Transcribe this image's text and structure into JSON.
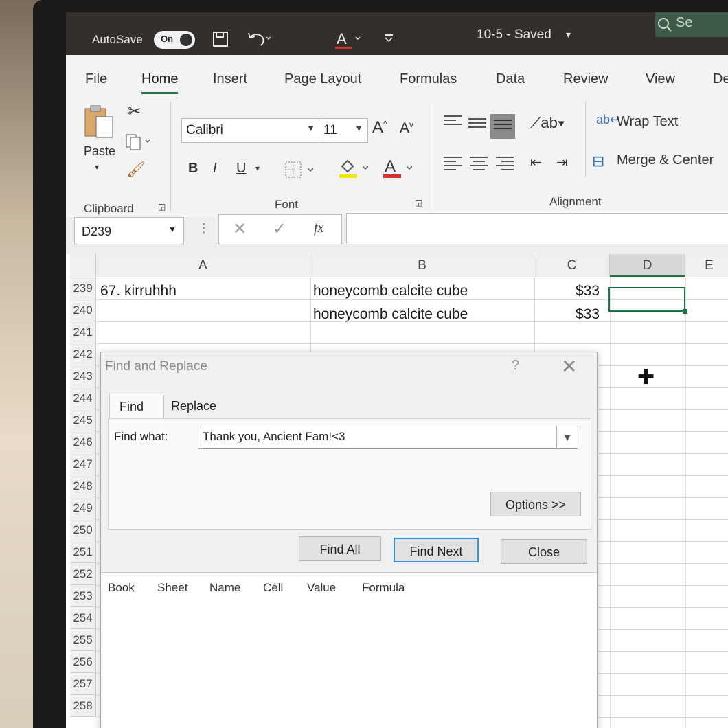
{
  "titlebar": {
    "autosave_label": "AutoSave",
    "autosave_state": "On",
    "document_title": "10-5 - Saved",
    "title_dropdown_icon": "chevron-down-icon",
    "search_partial": "Se"
  },
  "ribbon_tabs": [
    "File",
    "Home",
    "Insert",
    "Page Layout",
    "Formulas",
    "Data",
    "Review",
    "View",
    "De"
  ],
  "ribbon": {
    "clipboard": {
      "paste_label": "Paste",
      "group_label": "Clipboard"
    },
    "font": {
      "font_name": "Calibri",
      "font_size": "11",
      "bold": "B",
      "italic": "I",
      "underline": "U",
      "group_label": "Font"
    },
    "alignment": {
      "wrap_text_label": "Wrap Text",
      "merge_center_label": "Merge & Center",
      "group_label": "Alignment"
    }
  },
  "formula_bar": {
    "name_box": "D239",
    "fx": "fx",
    "formula": ""
  },
  "grid": {
    "columns": [
      "A",
      "B",
      "C",
      "D",
      "E"
    ],
    "selected_column": "D",
    "rows": [
      {
        "num": "239",
        "a": "67. kirruhhh",
        "b": "honeycomb calcite cube",
        "c": "$33"
      },
      {
        "num": "240",
        "a": "",
        "b": "honeycomb calcite cube",
        "c": "$33"
      },
      {
        "num": "241",
        "a": "",
        "b": "",
        "c": ""
      },
      {
        "num": "242"
      },
      {
        "num": "243"
      },
      {
        "num": "244"
      },
      {
        "num": "245"
      },
      {
        "num": "246"
      },
      {
        "num": "247"
      },
      {
        "num": "248"
      },
      {
        "num": "249"
      },
      {
        "num": "250"
      },
      {
        "num": "251"
      },
      {
        "num": "252"
      },
      {
        "num": "253"
      },
      {
        "num": "254"
      },
      {
        "num": "255"
      },
      {
        "num": "256"
      },
      {
        "num": "257"
      },
      {
        "num": "258"
      }
    ]
  },
  "dialog": {
    "title": "Find and Replace",
    "help": "?",
    "close_symbol": "✕",
    "tabs": [
      "Find",
      "Replace"
    ],
    "active_tab": "Find",
    "find_what_label": "Find what:",
    "find_what_value": "Thank you, Ancient Fam!<3",
    "options_button": "Options >>",
    "find_all_button": "Find All",
    "find_next_button": "Find Next",
    "close_button": "Close",
    "result_columns": [
      "Book",
      "Sheet",
      "Name",
      "Cell",
      "Value",
      "Formula"
    ]
  }
}
